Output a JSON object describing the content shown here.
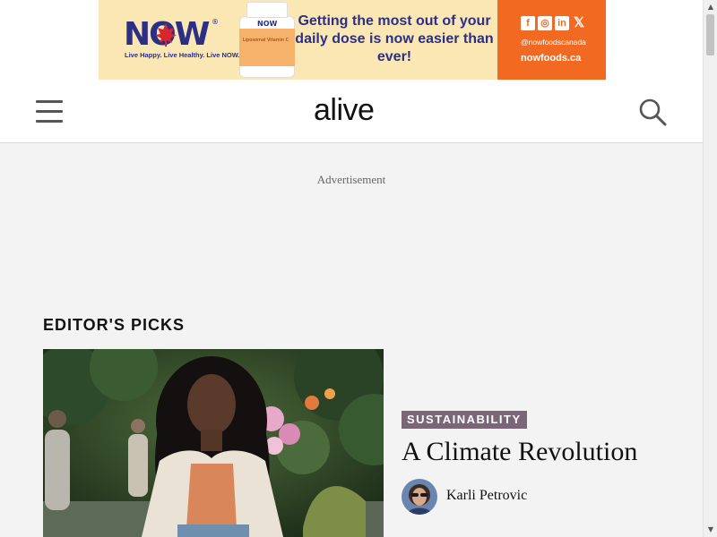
{
  "ad_banner": {
    "brand": "NOW",
    "registered": "®",
    "tagline": "Live Happy. Live Healthy. Live NOW.",
    "bottle_brand": "NOW",
    "bottle_text": "Liposomal Vitamin C",
    "headline": "Getting the most out of your daily dose is now easier than ever!",
    "social_icons": [
      "f",
      "ig",
      "in",
      "X"
    ],
    "handle": "@nowfoodscanada",
    "website": "nowfoods.ca",
    "colors": {
      "background": "#fbe7b4",
      "brand_blue": "#2c2f86",
      "orange": "#f26a21",
      "leaf_red": "#d7262d"
    }
  },
  "header": {
    "logo": "alive",
    "menu_icon": "hamburger-menu-icon",
    "search_icon": "search-icon"
  },
  "advertisement_label": "Advertisement",
  "editors_picks": {
    "title": "EDITOR'S PICKS",
    "featured": {
      "category": "SUSTAINABILITY",
      "headline": "A Climate Revolution",
      "author": "Karli Petrovic",
      "category_color": "#7a6676"
    }
  },
  "scrollbar": {
    "up": "▲",
    "down": "▼"
  }
}
